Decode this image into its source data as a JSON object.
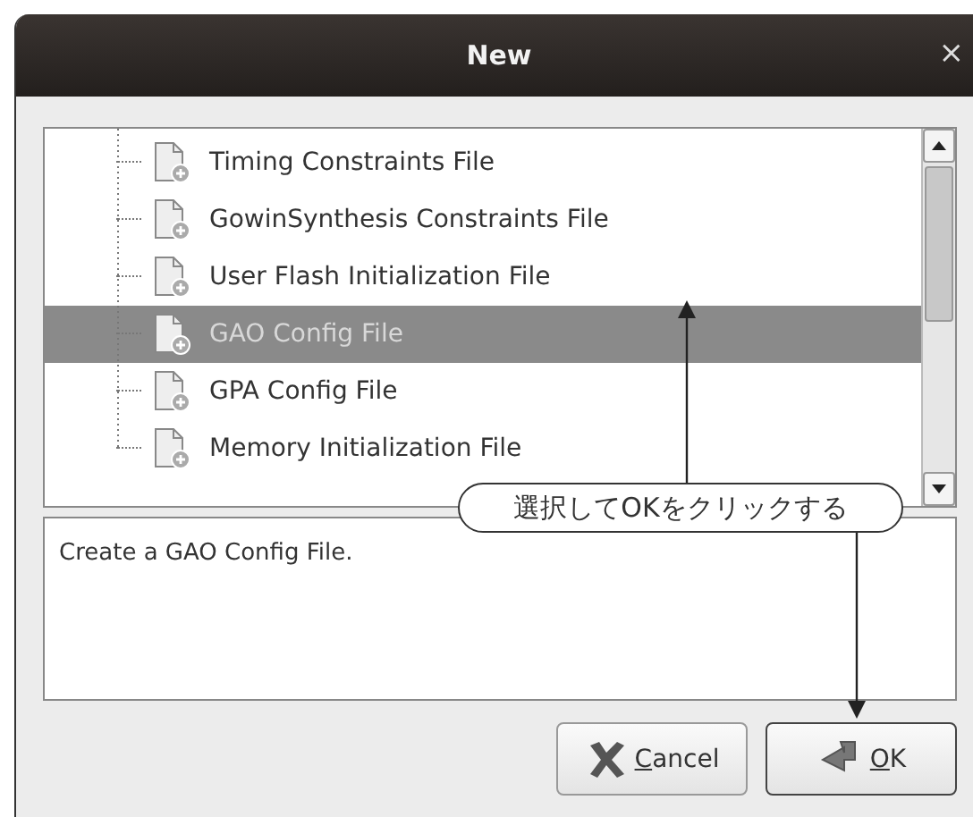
{
  "window": {
    "title": "New",
    "close": "×"
  },
  "file_types": [
    {
      "label": "Timing Constraints File",
      "selected": false
    },
    {
      "label": "GowinSynthesis Constraints File",
      "selected": false
    },
    {
      "label": "User Flash Initialization File",
      "selected": false
    },
    {
      "label": "GAO Config File",
      "selected": true
    },
    {
      "label": "GPA Config File",
      "selected": false
    },
    {
      "label": "Memory Initialization File",
      "selected": false
    }
  ],
  "description": "Create a GAO Config File.",
  "buttons": [
    {
      "label": "Cancel",
      "kind": "cancel"
    },
    {
      "label": "OK",
      "kind": "ok"
    }
  ],
  "callout": "選択してOKをクリックする"
}
